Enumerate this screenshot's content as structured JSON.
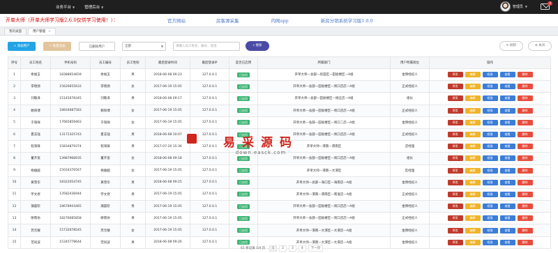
{
  "topbar": {
    "nav": [
      {
        "label": "业务平台"
      },
      {
        "label": "管理后台"
      }
    ],
    "user": {
      "name": "管理员"
    },
    "mail_count": "0"
  },
  "banner": {
    "warning": "开单大师（开单大师学习版2.6.0仅供学习使用！）：",
    "links": [
      "官方网站",
      "房客源采集",
      "内网app",
      "新房分销系统学习版1.0.0"
    ]
  },
  "tabs": [
    {
      "label": "我的桌面"
    },
    {
      "label": "用户管理",
      "close": "×"
    }
  ],
  "toolbar": {
    "add": "+ 添加用户",
    "batch": "+ 批量添加",
    "deleted": "已删除用户",
    "select_value": "全部",
    "search_placeholder": "请输入员工姓名、编号、电话",
    "search": "搜索",
    "refresh": "刷新",
    "close": "关闭"
  },
  "table": {
    "headers": [
      "序号",
      "员工姓名",
      "手机号码",
      "员工编号",
      "员工性别",
      "最后登录时间",
      "最后登录IP",
      "是否已启用",
      "所属部门",
      "用户所属岗位",
      "操作"
    ],
    "actions": [
      "停用",
      "编辑",
      "权限",
      "查看",
      "删除"
    ],
    "rows": [
      [
        "1",
        "余福玉",
        "18388654659",
        "余福玉",
        "男",
        "2018-06-08 09:23",
        "127.0.0.1",
        "已启用",
        "开单大师—总部—房田区—田坂楼区—A组",
        "金牌经纪人"
      ],
      [
        "2",
        "李德源",
        "15626655633",
        "李德源",
        "女",
        "2017-06-19 15:05",
        "127.0.0.1",
        "已启用",
        "开单大师—总部—田坂楼区—周口店店—A组",
        "正式经纪人"
      ],
      [
        "3",
        "刘敬泽",
        "15145678345",
        "刘敬泽",
        "男",
        "2018-06-08 09:17",
        "127.0.0.1",
        "已启用",
        "开单大师—总部—田坂楼区—杨庄店—A组",
        "组长"
      ],
      [
        "4",
        "赖阳博",
        "18834687583",
        "赖阳博",
        "女",
        "2017-06-19 15:05",
        "127.0.0.1",
        "已启用",
        "开单大师—总部—田坂楼区—周口店店—A组",
        "正式经纪人"
      ],
      [
        "5",
        "于瑞祥",
        "17665859463",
        "于瑞祥",
        "女",
        "2017-06-19 15:05",
        "127.0.0.1",
        "已启用",
        "开单大师—总部—田坂楼区—周口二店—A组",
        "金牌经纪人"
      ],
      [
        "6",
        "夏志强",
        "13172325743",
        "夏志强",
        "男",
        "2018-06-08 10:07",
        "127.0.0.1",
        "已启用",
        "开单大师—总部—田坂楼区—周口店店—A组",
        "正式经纪人"
      ],
      [
        "7",
        "程海锋",
        "15834879374",
        "程海锋",
        "男",
        "2017-07-20 15:36",
        "127.0.0.1",
        "已启用",
        "开单大师—渭南—渭南区",
        "店经理"
      ],
      [
        "8",
        "董齐宽",
        "13987968935",
        "董齐宽",
        "女",
        "2018-06-08 09:18",
        "127.0.0.1",
        "已启用",
        "开单大师—总部—田坂楼区—周口店店—A组",
        "组长"
      ],
      [
        "9",
        "杨顺越",
        "15034376567",
        "杨顺越",
        "女",
        "2017-06-19 15:05",
        "127.0.0.1",
        "已启用",
        "开单大师—渭南—大渭区",
        "区经理"
      ],
      [
        "10",
        "黄雪华",
        "18322054745",
        "黄雪华",
        "男",
        "2018-06-08 09:25",
        "127.0.0.1",
        "已启用",
        "开单大师—总部—海口区—海南店—A组",
        "金牌经纪人"
      ],
      [
        "11",
        "宇文煜",
        "13582436944",
        "宇文煜",
        "男",
        "2017-06-19 15:05",
        "127.0.0.1",
        "已启用",
        "开单大师—渭南—渭南区—南淮店—A组",
        "正式经纪人"
      ],
      [
        "12",
        "蒲晨钦",
        "18678943465",
        "蒲晨钦",
        "男",
        "2017-06-19 15:05",
        "127.0.0.1",
        "已启用",
        "开单大师—总部—田坂楼区—周口店店—A组",
        "金牌经纪人"
      ],
      [
        "13",
        "廖南坊",
        "18276685858",
        "廖南坊",
        "男",
        "2017-06-19 15:05",
        "127.0.0.1",
        "已启用",
        "开单大师—总部—田坂楼区—周口店店—A组",
        "正式经纪人"
      ],
      [
        "14",
        "苏元耀",
        "15732678545",
        "苏元耀",
        "女",
        "2017-06-19 15:05",
        "127.0.0.1",
        "已启用",
        "开单大师—渭南—大渭区—大渭店—A组",
        "金牌经纪人"
      ],
      [
        "15",
        "范同波",
        "15345778644",
        "范同波",
        "男",
        "2018-06-08 09:26",
        "127.0.0.1",
        "已启用",
        "开单大师—渭南—大渭区—大渭店—A组",
        "金牌经纪人"
      ]
    ]
  },
  "pager": {
    "summary": "61 条记录 1/4 页",
    "pages": [
      "1",
      "2",
      "3",
      "4"
    ],
    "next": "下一页"
  },
  "watermark": {
    "line1": "易采源码",
    "line2": "down.easck.com"
  },
  "colors": {
    "topbar": "#1f1f1f",
    "primary": "#22a4e6",
    "warning_text": "#d50000",
    "link": "#4c77c9",
    "enabled": "#3cb371"
  }
}
